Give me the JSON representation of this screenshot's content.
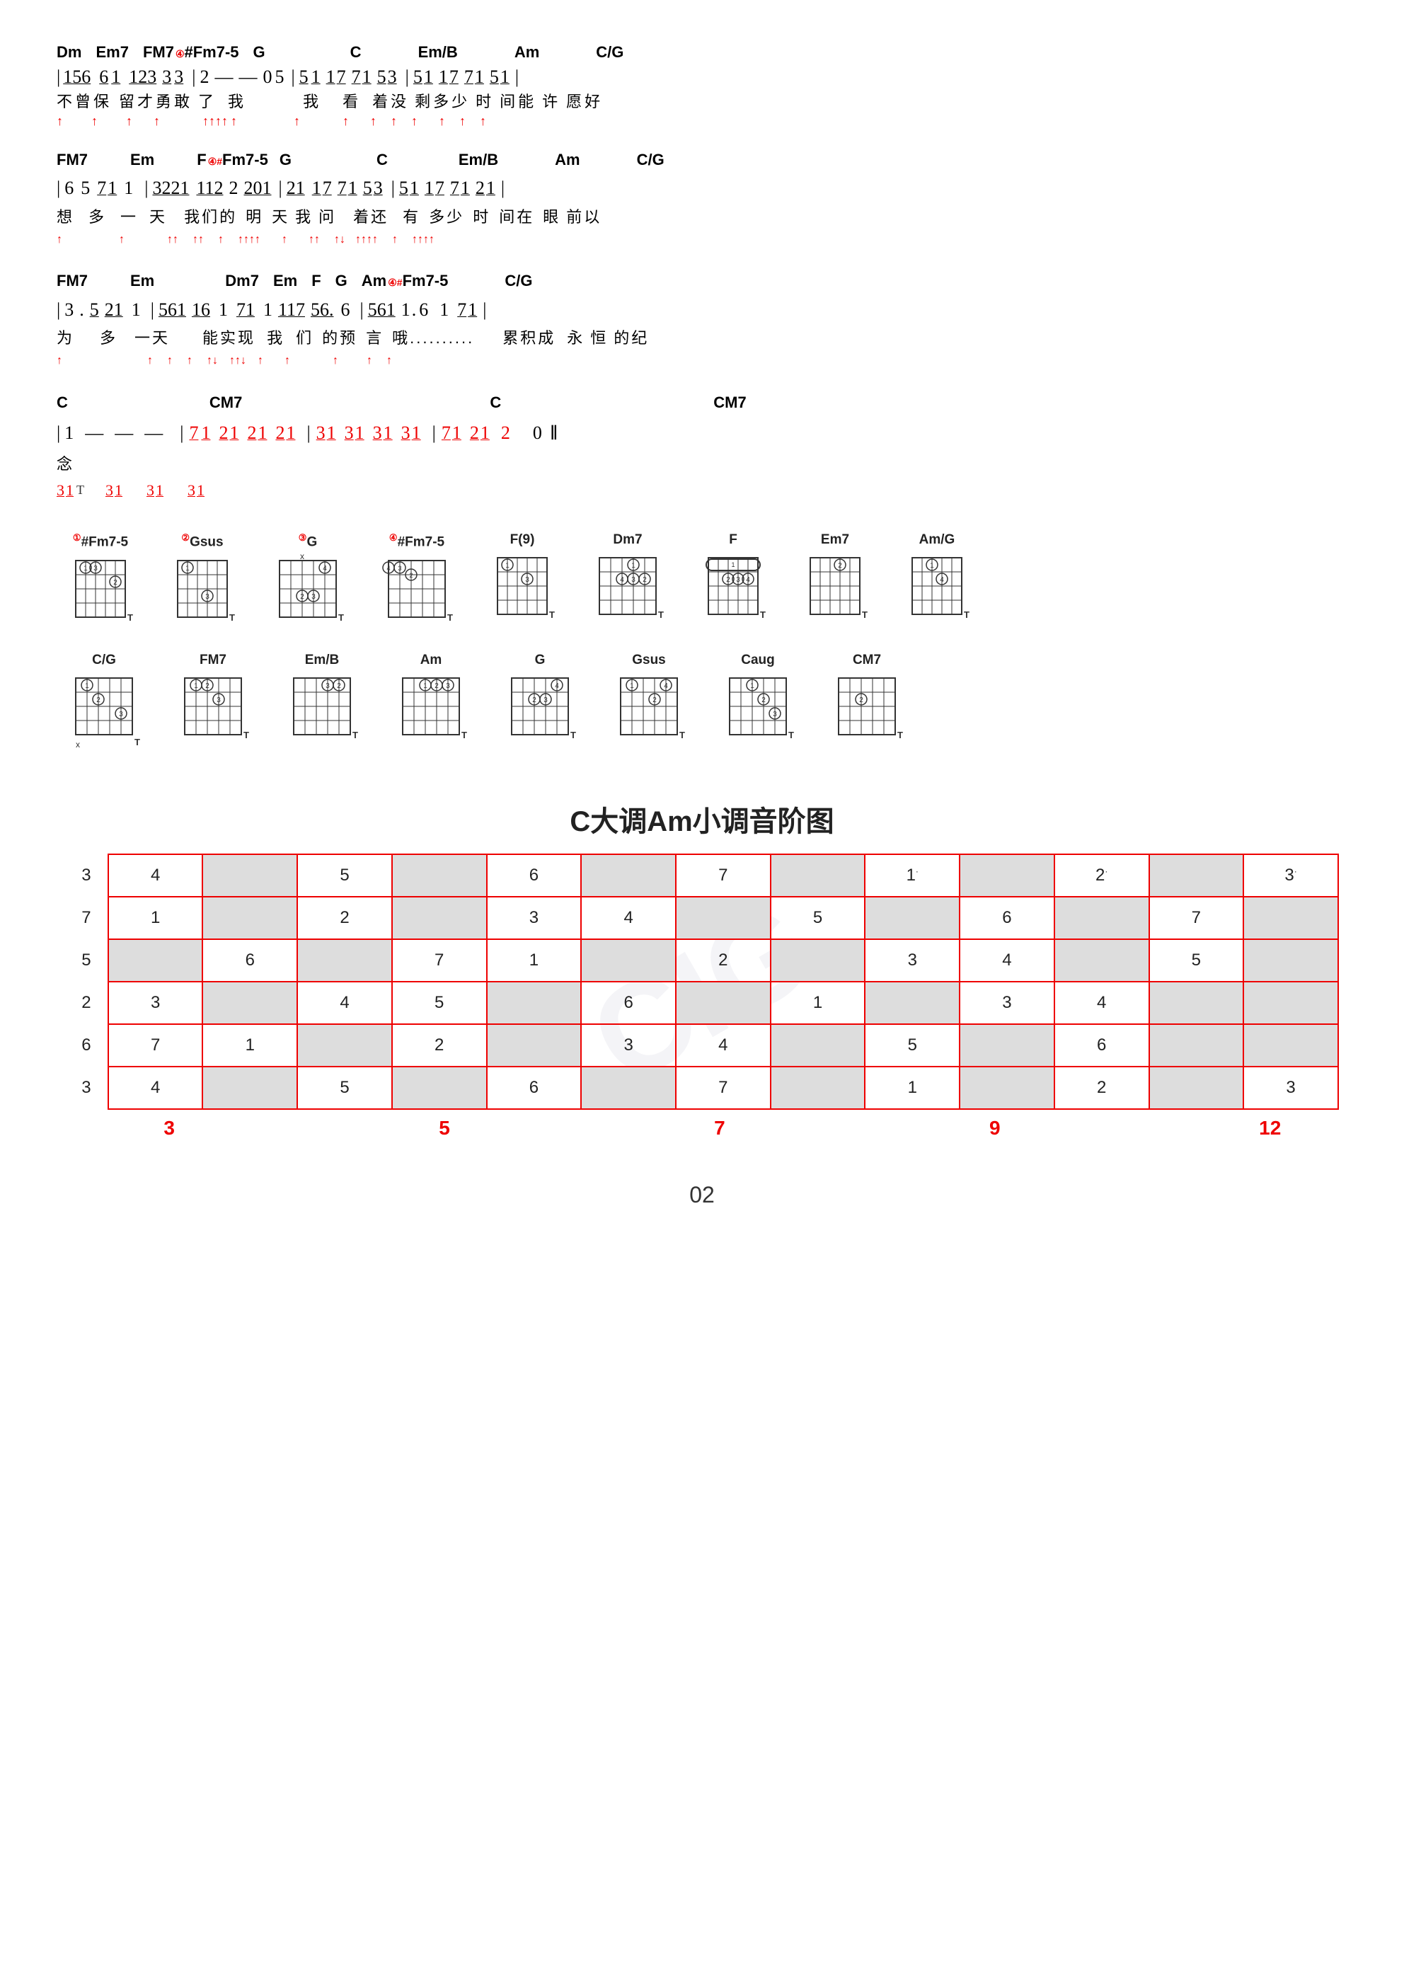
{
  "watermark": "CIG",
  "page_number": "02",
  "scale_title": "C大调Am小调音阶图",
  "music_rows": [
    {
      "id": "row1",
      "chords": "Dm  Em7  FM7⁴#Fm7-5  G                    C        Em/B      Am       C/G",
      "notes": "| 156  6̲1̲  1̲2̲3̲  3̲3̲ | 2  —  —  0 5 | 5̲1̲  1̲7̲  7̲1̲  5̲3̲ | 5̲1̲  1̲7̲  7̲1̲  5̲1̲ |",
      "lyrics": "不曾保   留才勇敢   了   我            我    看    着没  剩多少   时  间能  许  愿好",
      "arrows": "↑      ↑       ↑     ↑   ↑↑↑↑ ↑         ↑        ↑   ↑   ↑       ↑   ↑    ↑   ↑"
    }
  ],
  "chord_diagrams_row1": [
    {
      "name": "①#Fm7-5",
      "frets": "x02323",
      "label": "T"
    },
    {
      "name": "②Gsus",
      "frets": "310033",
      "label": "T"
    },
    {
      "name": "③G",
      "frets": "320003x",
      "label": "T"
    },
    {
      "name": "④#Fm7-5",
      "frets": "242322",
      "label": "T"
    },
    {
      "name": "F(9)",
      "frets": "133211",
      "label": "T"
    },
    {
      "name": "Dm7",
      "frets": "xx0211",
      "label": "T"
    },
    {
      "name": "F",
      "frets": "133211",
      "label": "T"
    },
    {
      "name": "Em7",
      "frets": "022033",
      "label": "T"
    },
    {
      "name": "Am/G",
      "frets": "302210",
      "label": "T"
    }
  ],
  "chord_diagrams_row2": [
    {
      "name": "C/G",
      "frets": "332010",
      "label": "T"
    },
    {
      "name": "FM7",
      "frets": "133210",
      "label": "T"
    },
    {
      "name": "Em/B",
      "frets": "x22000",
      "label": "T"
    },
    {
      "name": "Am",
      "frets": "x02210",
      "label": "T"
    },
    {
      "name": "G",
      "frets": "320003",
      "label": "T"
    },
    {
      "name": "Gsus",
      "frets": "310033",
      "label": "T"
    },
    {
      "name": "Caug",
      "frets": "x32110",
      "label": "T"
    },
    {
      "name": "CM7",
      "frets": "x32000",
      "label": "T"
    }
  ],
  "scale_rows": [
    {
      "label": "3",
      "cells": [
        "4",
        "",
        "5",
        "",
        "6",
        "",
        "7",
        "",
        "1̈",
        "",
        "2̈",
        "",
        "3̇"
      ]
    },
    {
      "label": "7",
      "cells": [
        "1",
        "",
        "2",
        "",
        "3",
        "4",
        "",
        "5",
        "",
        "6",
        "",
        "7"
      ]
    },
    {
      "label": "5",
      "cells": [
        "",
        "6",
        "",
        "7",
        "1",
        "",
        "2",
        "",
        "3",
        "4",
        "",
        "5"
      ]
    },
    {
      "label": "2",
      "cells": [
        "3",
        "",
        "4",
        "5",
        "",
        "6",
        "",
        "1",
        "",
        "3",
        "4"
      ]
    },
    {
      "label": "6",
      "cells": [
        "7",
        "1",
        "",
        "2",
        "",
        "3",
        "4",
        "",
        "5",
        "",
        "6"
      ]
    },
    {
      "label": "3",
      "cells": [
        "4",
        "",
        "5",
        "",
        "6",
        "",
        "7",
        "",
        "1",
        "",
        "2",
        "",
        "3"
      ]
    }
  ],
  "scale_col_numbers": [
    "3",
    "5",
    "7",
    "9",
    "12"
  ],
  "labels": {
    "page_number": "02"
  }
}
